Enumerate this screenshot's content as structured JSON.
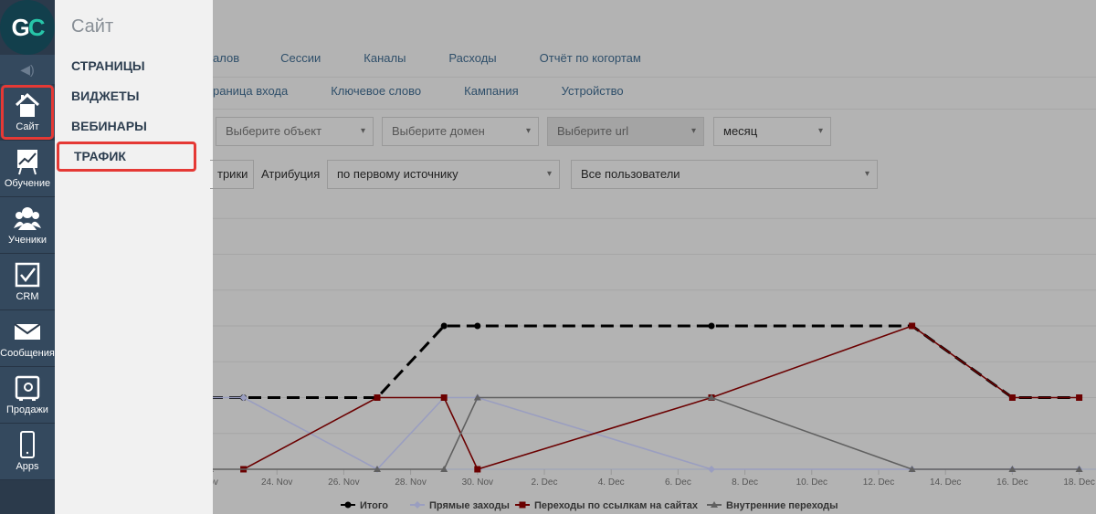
{
  "sidebar": {
    "logo": "GC",
    "items": [
      {
        "label": "Сайт",
        "icon": "home-icon",
        "active": true
      },
      {
        "label": "Обучение",
        "icon": "chart-board-icon"
      },
      {
        "label": "Ученики",
        "icon": "users-icon"
      },
      {
        "label": "CRM",
        "icon": "checkbox-icon"
      },
      {
        "label": "Сообщения",
        "icon": "envelope-icon"
      },
      {
        "label": "Продажи",
        "icon": "safe-icon"
      },
      {
        "label": "Apps",
        "icon": "phone-icon"
      }
    ]
  },
  "flyout": {
    "title": "Сайт",
    "items": [
      "СТРАНИЦЫ",
      "ВИДЖЕТЫ",
      "ВЕБИНАРЫ",
      "ТРАФИК"
    ],
    "selected": "ТРАФИК"
  },
  "tabs1": [
    "алов",
    "Сессии",
    "Каналы",
    "Расходы",
    "Отчёт по когортам"
  ],
  "tabs2": [
    "раница входа",
    "Ключевое слово",
    "Кампания",
    "Устройство"
  ],
  "filters": {
    "object": "Выберите объект",
    "domain": "Выберите домен",
    "url": "Выберите url",
    "period": "месяц",
    "metrics_btn": "трики",
    "attribution_label": "Атрибуция",
    "attribution": "по первому источнику",
    "users": "Все пользователи"
  },
  "chart_data": {
    "type": "line",
    "x_ticks": [
      "Nov",
      "24. Nov",
      "26. Nov",
      "28. Nov",
      "30. Nov",
      "2. Dec",
      "4. Dec",
      "6. Dec",
      "8. Dec",
      "10. Dec",
      "12. Dec",
      "14. Dec",
      "16. Dec",
      "18. Dec"
    ],
    "grid": true,
    "legend": "bottom",
    "series": [
      {
        "name": "Итого",
        "color": "#000000",
        "dash": true,
        "marker": "circle",
        "points": [
          [
            "22 Nov",
            1
          ],
          [
            "23 Nov",
            1
          ],
          [
            "27 Nov",
            1
          ],
          [
            "29 Nov",
            2
          ],
          [
            "30 Nov",
            2
          ],
          [
            "7 Dec",
            2
          ],
          [
            "13 Dec",
            2
          ],
          [
            "16 Dec",
            1
          ],
          [
            "18 Dec",
            1
          ]
        ]
      },
      {
        "name": "Прямые заходы",
        "color": "#9a9ec0",
        "marker": "diamond",
        "points": [
          [
            "22 Nov",
            1
          ],
          [
            "23 Nov",
            1
          ],
          [
            "27 Nov",
            0
          ],
          [
            "29 Nov",
            1
          ],
          [
            "30 Nov",
            1
          ],
          [
            "7 Dec",
            0
          ],
          [
            "13 Dec",
            0
          ],
          [
            "16 Dec",
            0
          ],
          [
            "18 Dec",
            0
          ]
        ]
      },
      {
        "name": "Переходы по ссылкам на сайтах",
        "color": "#6b0000",
        "marker": "square",
        "points": [
          [
            "23 Nov",
            0
          ],
          [
            "27 Nov",
            1
          ],
          [
            "29 Nov",
            1
          ],
          [
            "30 Nov",
            0
          ],
          [
            "7 Dec",
            1
          ],
          [
            "13 Dec",
            2
          ],
          [
            "16 Dec",
            1
          ],
          [
            "18 Dec",
            1
          ]
        ]
      },
      {
        "name": "Внутренние переходы",
        "color": "#606060",
        "marker": "triangle",
        "points": [
          [
            "22 Nov",
            0
          ],
          [
            "27 Nov",
            0
          ],
          [
            "29 Nov",
            0
          ],
          [
            "30 Nov",
            1
          ],
          [
            "7 Dec",
            1
          ],
          [
            "13 Dec",
            0
          ],
          [
            "16 Dec",
            0
          ],
          [
            "18 Dec",
            0
          ]
        ]
      }
    ]
  }
}
